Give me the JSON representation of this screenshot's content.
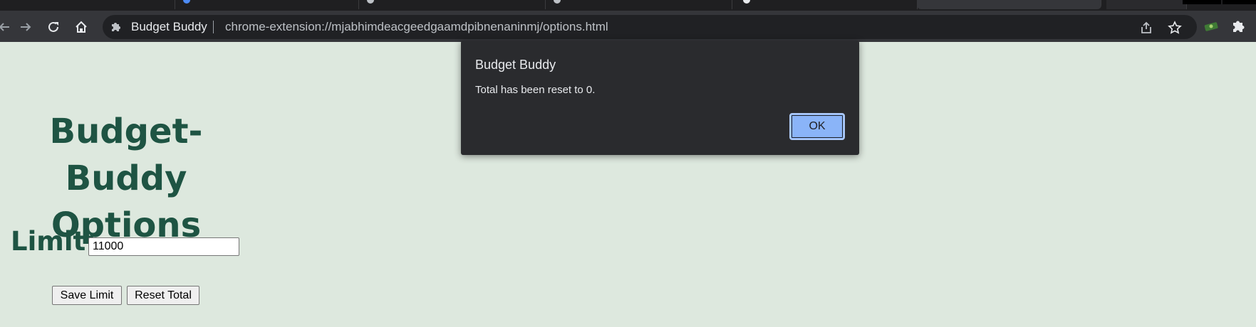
{
  "browser": {
    "omnibox": {
      "site_name": "Budget Buddy",
      "url": "chrome-extension://mjabhimdeacgeedgaamdpibnenaninmj/options.html"
    },
    "icons": {
      "back": "back-arrow-icon",
      "forward": "forward-arrow-icon",
      "reload": "reload-icon",
      "home": "home-icon",
      "extension": "puzzle-piece-icon",
      "share": "share-icon",
      "bookmark": "star-icon"
    }
  },
  "page": {
    "title_line1": "Budget-Buddy",
    "title_line2": "Options",
    "limit_label": "Limit:",
    "limit_value": "11000",
    "save_button": "Save Limit",
    "reset_button": "Reset Total"
  },
  "dialog": {
    "title": "Budget Buddy",
    "message": "Total has been reset to 0.",
    "ok_label": "OK"
  },
  "colors": {
    "page_background": "#dde8de",
    "heading": "#1e5443",
    "dialog_background": "#2a2b2e",
    "ok_button": "#8ab4f8"
  }
}
